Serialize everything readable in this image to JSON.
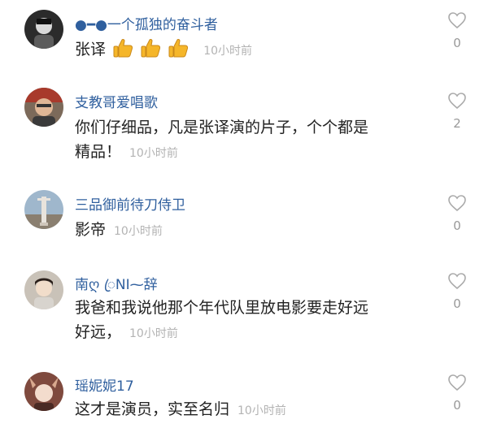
{
  "comments": [
    {
      "username": "●━●一个孤独的奋斗者",
      "text": "张译",
      "emojis": [
        "thumbs-up",
        "thumbs-up",
        "thumbs-up"
      ],
      "time": "10小时前",
      "likes": "0"
    },
    {
      "username": "支教哥爱唱歌",
      "text_line1": "你们仔细品，凡是张译演的片子，个个都是",
      "text_line2": "精品！",
      "time": "10小时前",
      "likes": "2"
    },
    {
      "username": "三品御前待刀侍卫",
      "text": "影帝",
      "time": "10小时前",
      "likes": "0"
    },
    {
      "username": "南ღ ꦿNI⁓辞",
      "text_line1": "我爸和我说他那个年代队里放电影要走好远",
      "text_line2": "好远，",
      "time": "10小时前",
      "likes": "0"
    },
    {
      "username": "瑶妮妮17",
      "text": "这才是演员，实至名归",
      "time": "10小时前",
      "likes": "0"
    }
  ],
  "colors": {
    "username": "#2f5f9e",
    "body_text": "#222222",
    "timestamp": "#b3b3b3",
    "like_icon": "#aaaaaa"
  },
  "icons": [
    "heart-outline-icon",
    "thumbs-up-emoji"
  ]
}
